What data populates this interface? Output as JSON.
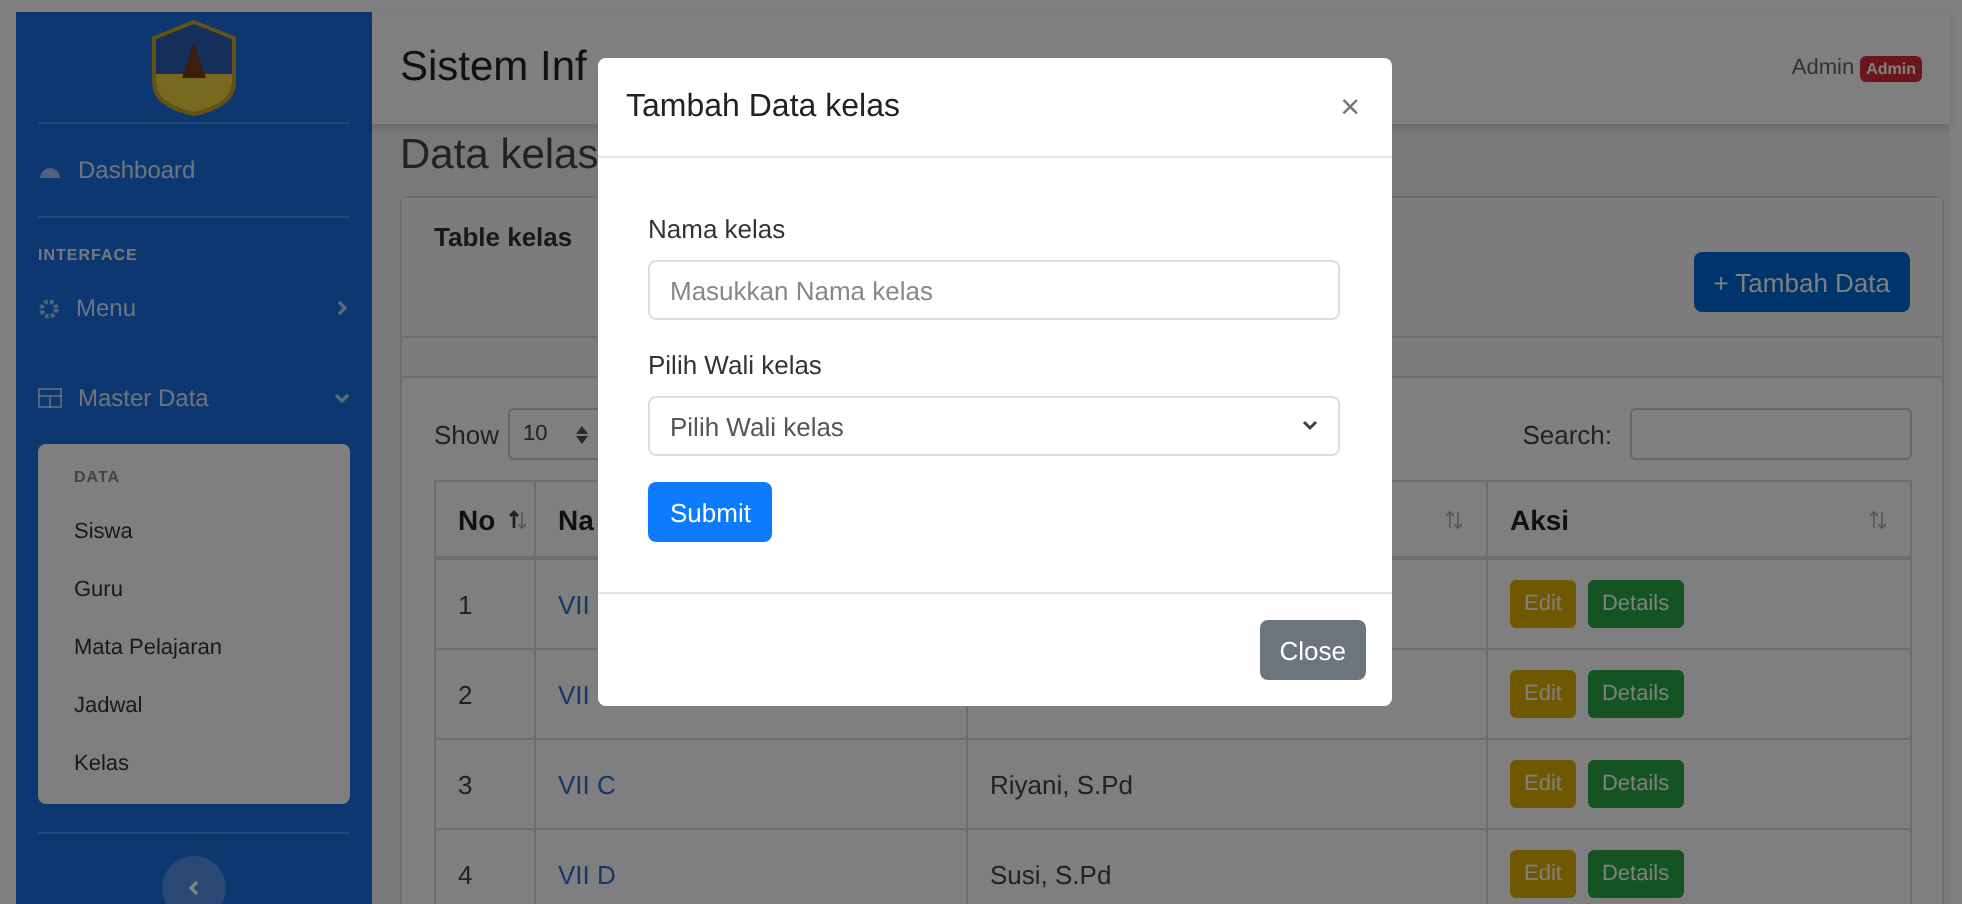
{
  "header": {
    "title": "Sistem Inf",
    "user": "Admin",
    "role_badge": "Admin"
  },
  "sidebar": {
    "items": [
      {
        "kind": "link",
        "label": "Dashboard"
      },
      {
        "kind": "heading",
        "label": "INTERFACE"
      },
      {
        "kind": "group",
        "label": "Menu",
        "expanded": false
      },
      {
        "kind": "group",
        "label": "Master Data",
        "expanded": true,
        "submenu": {
          "heading": "DATA",
          "items": [
            "Siswa",
            "Guru",
            "Mata Pelajaran",
            "Jadwal",
            "Kelas"
          ]
        }
      }
    ]
  },
  "page": {
    "heading": "Data kelas",
    "card": {
      "title": "Table kelas",
      "add_button": "+ Tambah Data",
      "length": {
        "label": "Show",
        "value": "10"
      },
      "search": {
        "label": "Search:"
      },
      "table": {
        "columns": [
          {
            "label": "No",
            "sorted": true
          },
          {
            "label": "Na"
          },
          {
            "sorted": false
          },
          {
            "label": "Aksi",
            "sorted": false
          }
        ],
        "rows": [
          {
            "no": "1",
            "name": "VII",
            "actions": [
              "Edit",
              "Details"
            ]
          },
          {
            "no": "2",
            "name": "VII",
            "actions": [
              "Edit",
              "Details"
            ]
          },
          {
            "no": "3",
            "name": "VII C",
            "wali": "Riyani, S.Pd",
            "actions": [
              "Edit",
              "Details"
            ]
          },
          {
            "no": "4",
            "name": "VII D",
            "wali": "Susi, S.Pd",
            "actions": [
              "Edit",
              "Details"
            ]
          }
        ]
      }
    }
  },
  "modal": {
    "title": "Tambah Data kelas",
    "close_icon": "×",
    "fields": [
      {
        "kind": "text",
        "label": "Nama kelas",
        "placeholder": "Masukkan Nama kelas"
      },
      {
        "kind": "select",
        "label": "Pilih Wali kelas",
        "value": "Pilih Wali kelas"
      }
    ],
    "submit": "Submit",
    "close": "Close"
  }
}
